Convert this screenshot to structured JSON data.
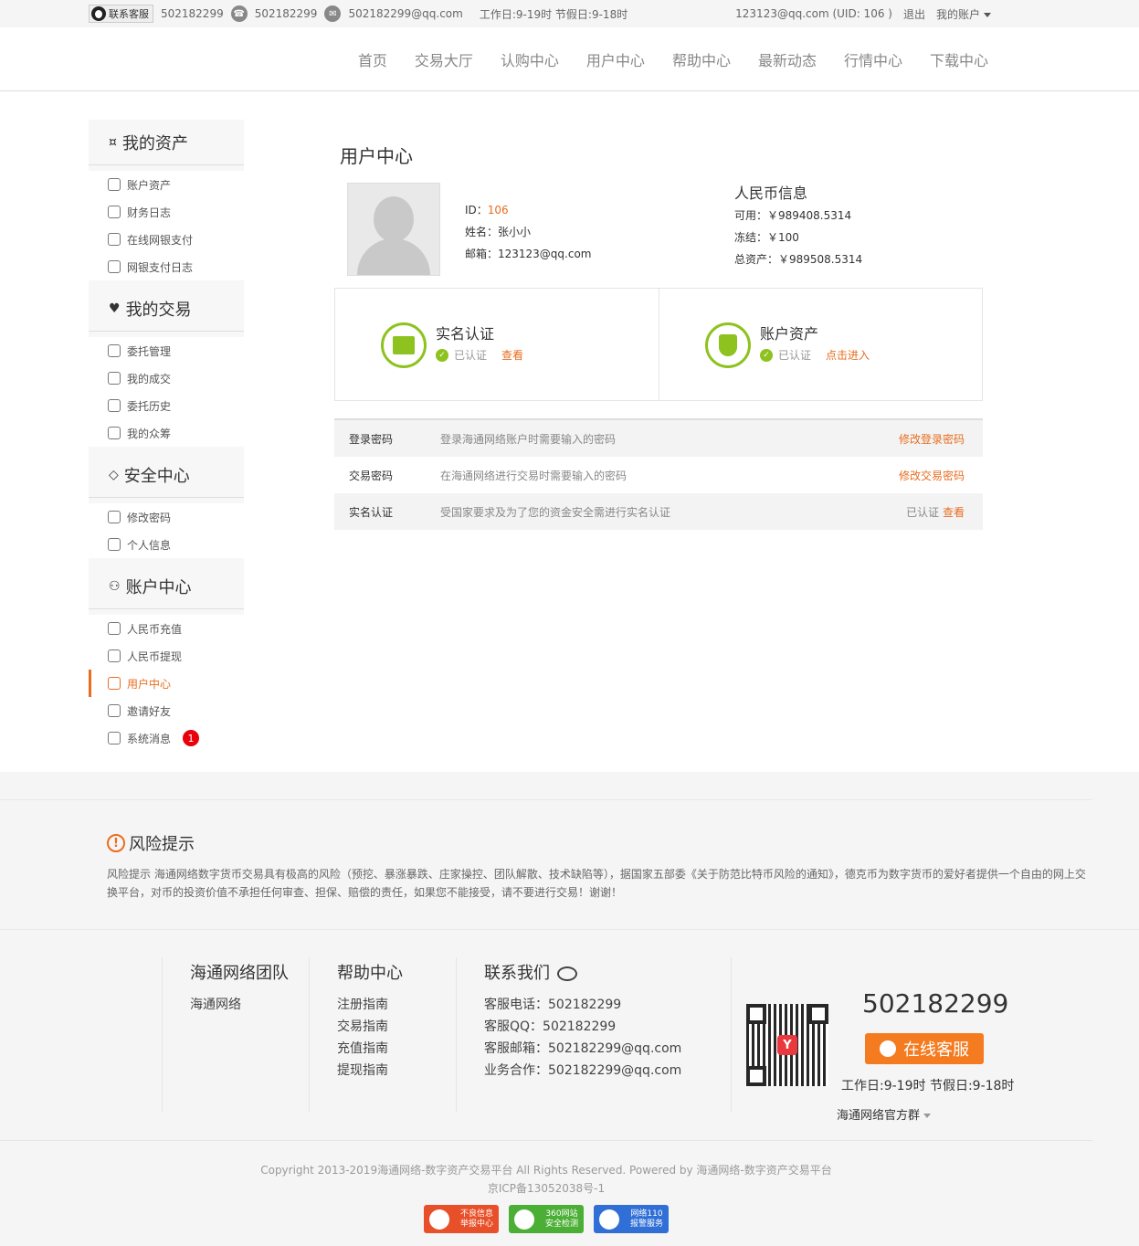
{
  "topbar": {
    "qq_label": "联系客服",
    "qq_number": "502182299",
    "phone": "502182299",
    "email": "502182299@qq.com",
    "hours": "工作日:9-19时 节假日:9-18时",
    "user": "123123@qq.com (UID: 106 )",
    "logout": "退出",
    "my_account": "我的账户"
  },
  "nav": [
    "首页",
    "交易大厅",
    "认购中心",
    "用户中心",
    "帮助中心",
    "最新动态",
    "行情中心",
    "下载中心"
  ],
  "sidebar": {
    "groups": [
      {
        "title": "我的资产",
        "items": [
          "账户资产",
          "财务日志",
          "在线网银支付",
          "网银支付日志"
        ]
      },
      {
        "title": "我的交易",
        "items": [
          "委托管理",
          "我的成交",
          "委托历史",
          "我的众筹"
        ]
      },
      {
        "title": "安全中心",
        "items": [
          "修改密码",
          "个人信息"
        ]
      },
      {
        "title": "账户中心",
        "items": [
          "人民币充值",
          "人民币提现",
          "用户中心",
          "邀请好友",
          "系统消息"
        ]
      }
    ],
    "active": "用户中心",
    "message_badge": "1"
  },
  "main": {
    "title": "用户中心",
    "user": {
      "id_label": "ID：",
      "id": "106",
      "name": "姓名：张小小",
      "email": "邮箱：123123@qq.com"
    },
    "rmb": {
      "title": "人民币信息",
      "available": "可用：￥989408.5314",
      "frozen": "冻结：￥100",
      "total": "总资产：￥989508.5314"
    },
    "cards": [
      {
        "title": "实名认证",
        "status": "已认证",
        "link": "查看"
      },
      {
        "title": "账户资产",
        "status": "已认证",
        "link": "点击进入"
      }
    ],
    "security": [
      {
        "name": "登录密码",
        "desc": "登录海通网络账户时需要输入的密码",
        "action": "修改登录密码"
      },
      {
        "name": "交易密码",
        "desc": "在海通网络进行交易时需要输入的密码",
        "action": "修改交易密码"
      },
      {
        "name": "实名认证",
        "desc": "受国家要求及为了您的资金安全需进行实名认证",
        "status": "已认证",
        "action": "查看"
      }
    ]
  },
  "risk": {
    "title": "风险提示",
    "text": "风险提示 海通网络数字货币交易具有极高的风险（预挖、暴涨暴跌、庄家操控、团队解散、技术缺陷等），据国家五部委《关于防范比特币风险的通知》，德克币为数字货币的爱好者提供一个自由的网上交换平台，对币的投资价值不承担任何审查、担保、赔偿的责任，如果您不能接受，请不要进行交易！谢谢！"
  },
  "footer": {
    "team": {
      "title": "海通网络团队",
      "items": [
        "海通网络"
      ]
    },
    "help": {
      "title": "帮助中心",
      "items": [
        "注册指南",
        "交易指南",
        "充值指南",
        "提现指南"
      ]
    },
    "contact": {
      "title": "联系我们",
      "items": [
        "客服电话：502182299",
        "客服QQ：502182299",
        "客服邮箱：502182299@qq.com",
        "业务合作：502182299@qq.com"
      ]
    },
    "phone": "502182299",
    "online_btn": "在线客服",
    "worktime": "工作日:9-19时 节假日:9-18时",
    "group": "海通网络官方群",
    "copyright": "Copyright 2013-2019海通网络-数字资产交易平台 All Rights Reserved. Powered by 海通网络-数字资产交易平台",
    "icp": "京ICP备13052038号-1",
    "badges": [
      {
        "line1": "不良信息",
        "line2": "举报中心",
        "color": "#e8502a"
      },
      {
        "line1": "360网站",
        "line2": "安全检测",
        "color": "#4caf35"
      },
      {
        "line1": "网络110",
        "line2": "报警服务",
        "color": "#2f6fd6"
      }
    ]
  }
}
